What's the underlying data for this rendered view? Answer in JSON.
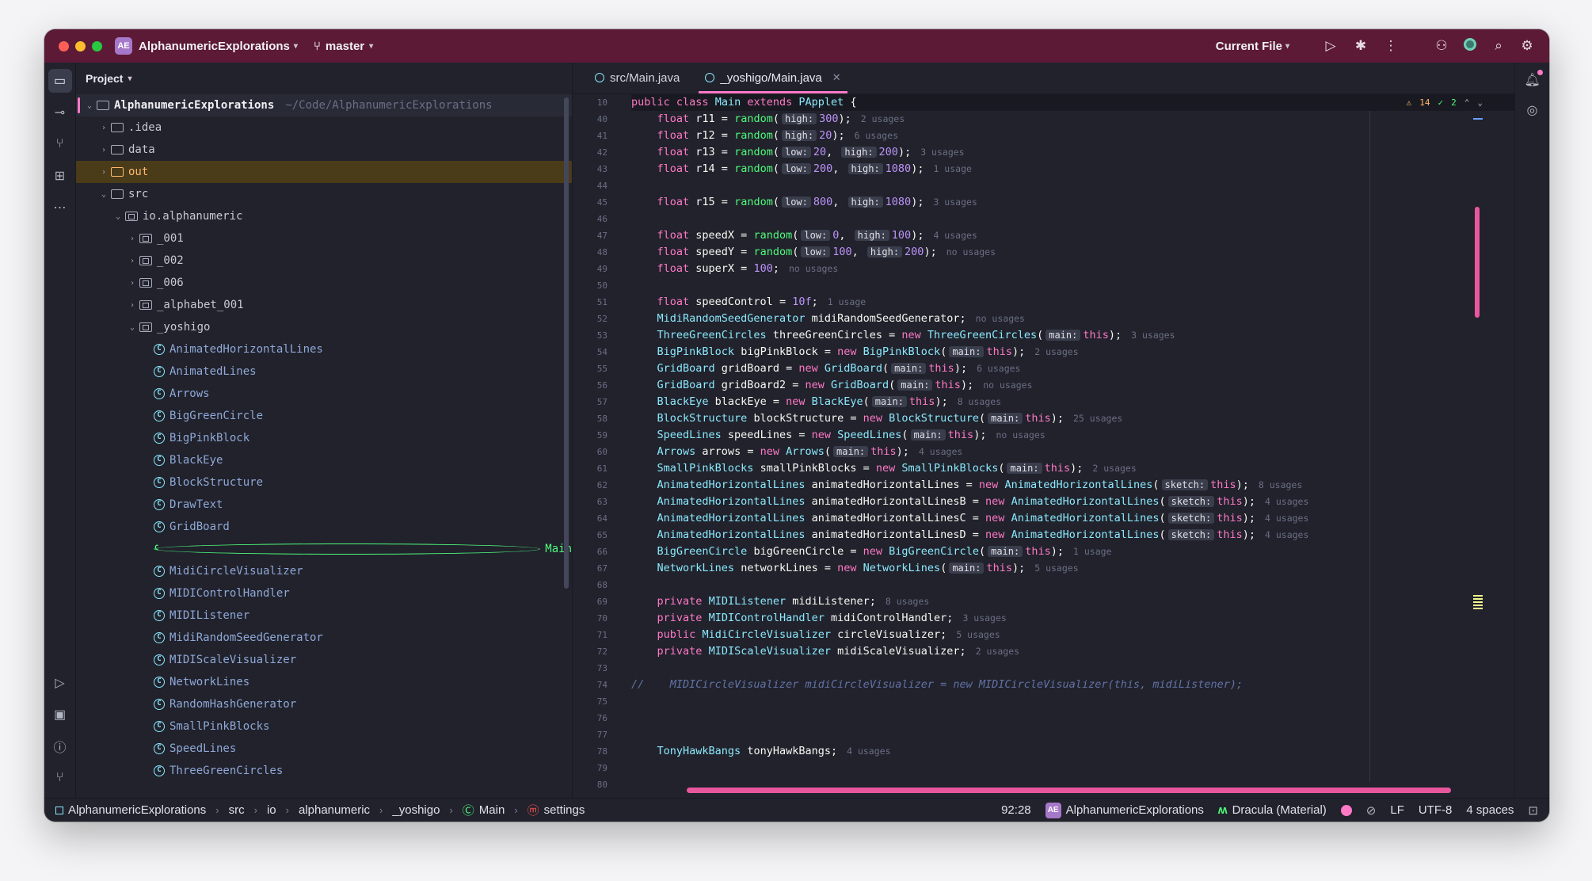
{
  "titlebar": {
    "project_badge": "AE",
    "project_name": "AlphanumericExplorations",
    "branch": "master",
    "run_config": "Current File",
    "icons": [
      "run-icon",
      "debug-icon",
      "more-icon",
      "add-user-icon",
      "copilot-icon",
      "search-icon",
      "settings-icon"
    ]
  },
  "project_panel": {
    "title": "Project",
    "root": {
      "name": "AlphanumericExplorations",
      "path": "~/Code/AlphanumericExplorations"
    },
    "folders": [
      ".idea",
      "data",
      "out",
      "src"
    ],
    "package": "io.alphanumeric",
    "subpackages": [
      "_001",
      "_002",
      "_006",
      "_alphabet_001",
      "_yoshigo"
    ],
    "classes": [
      "AnimatedHorizontalLines",
      "AnimatedLines",
      "Arrows",
      "BigGreenCircle",
      "BigPinkBlock",
      "BlackEye",
      "BlockStructure",
      "DrawText",
      "GridBoard",
      "Main",
      "MidiCircleVisualizer",
      "MIDIControlHandler",
      "MIDIListener",
      "MidiRandomSeedGenerator",
      "MIDIScaleVisualizer",
      "NetworkLines",
      "RandomHashGenerator",
      "SmallPinkBlocks",
      "SpeedLines",
      "ThreeGreenCircles"
    ]
  },
  "tabs": [
    {
      "label": "src/Main.java"
    },
    {
      "label": "_yoshigo/Main.java"
    }
  ],
  "editor": {
    "sticky_line_no": "10",
    "sticky": {
      "k1": "public",
      "k2": "class",
      "name": "Main",
      "k3": "extends",
      "super": "PApplet",
      "brace": "{"
    },
    "warnings": "14",
    "checks": "2",
    "line_numbers": [
      "40",
      "41",
      "42",
      "43",
      "44",
      "45",
      "46",
      "47",
      "48",
      "49",
      "50",
      "51",
      "52",
      "53",
      "54",
      "55",
      "56",
      "57",
      "58",
      "59",
      "60",
      "61",
      "62",
      "63",
      "64",
      "65",
      "66",
      "67",
      "68",
      "69",
      "70",
      "71",
      "72",
      "73",
      "74",
      "75",
      "76",
      "77",
      "78",
      "79",
      "80"
    ]
  },
  "statusbar": {
    "breadcrumbs": [
      "AlphanumericExplorations",
      "src",
      "io",
      "alphanumeric",
      "_yoshigo",
      "Main",
      "settings"
    ],
    "position": "92:28",
    "badge": "AE",
    "project": "AlphanumericExplorations",
    "theme": "Dracula (Material)",
    "line_ending": "LF",
    "encoding": "UTF-8",
    "indent": "4 spaces"
  }
}
